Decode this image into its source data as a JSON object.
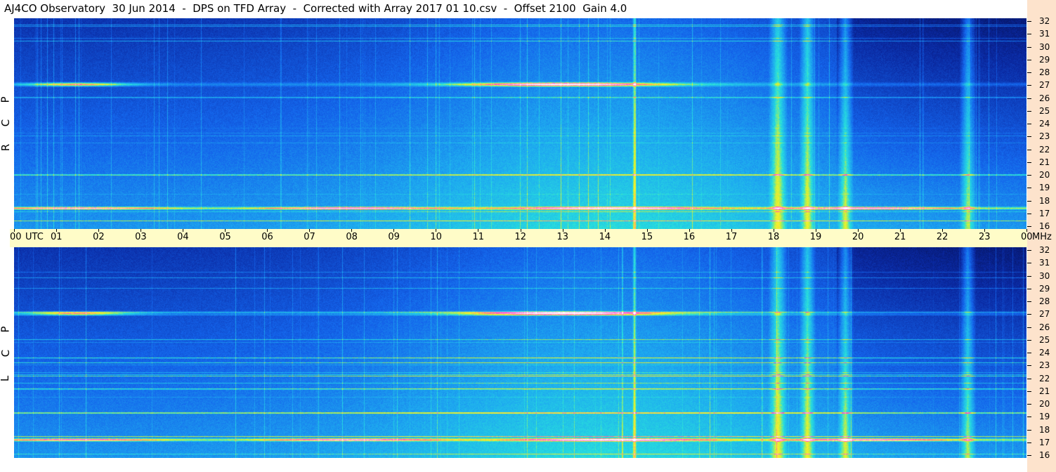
{
  "title": "AJ4CO Observatory  30 Jun 2014  -  DPS on TFD Array  -  Corrected with Array 2017 01 10.csv  -  Offset 2100  Gain 4.0",
  "time_axis": {
    "labels": [
      "00",
      "01",
      "02",
      "03",
      "04",
      "05",
      "06",
      "07",
      "08",
      "09",
      "10",
      "11",
      "12",
      "13",
      "14",
      "15",
      "16",
      "17",
      "18",
      "19",
      "20",
      "21",
      "22",
      "23",
      "00"
    ],
    "utc_label": "UTC",
    "mhz_label": "MHz"
  },
  "freq_axis": {
    "labels": [
      "32",
      "31",
      "30",
      "29",
      "28",
      "27",
      "26",
      "25",
      "24",
      "23",
      "22",
      "21",
      "20",
      "19",
      "18",
      "17",
      "16"
    ]
  },
  "panels": {
    "rcp": {
      "letters": [
        "P",
        "C",
        "R"
      ]
    },
    "lcp": {
      "letters": [
        "P",
        "C",
        "L"
      ]
    }
  },
  "colors": {
    "background_low": "#0a1a6a",
    "mid": "#1f6fe6",
    "high": "#21d3e8",
    "peak": "#f0f030",
    "saturation": "#ff44cc",
    "axis_bg": "#fffcc8",
    "right_strip_bg": "#fde3cc"
  },
  "chart_data": [
    {
      "type": "heatmap",
      "title": "",
      "polarization": "RCP",
      "x_unit": "UTC hour",
      "y_unit": "MHz",
      "xlim": [
        0,
        24
      ],
      "ylim": [
        16,
        32
      ],
      "bright_bands_mhz": [
        27,
        17.6
      ],
      "broadband_hours": [
        14.7,
        18.1,
        18.8,
        19.7,
        22.6
      ]
    },
    {
      "type": "heatmap",
      "title": "",
      "polarization": "LCP",
      "x_unit": "UTC hour",
      "y_unit": "MHz",
      "xlim": [
        0,
        24
      ],
      "ylim": [
        16,
        32
      ],
      "bright_bands_mhz": [
        27,
        17.4
      ],
      "broadband_hours": [
        14.7,
        18.1,
        18.8,
        19.7,
        22.6
      ]
    }
  ]
}
